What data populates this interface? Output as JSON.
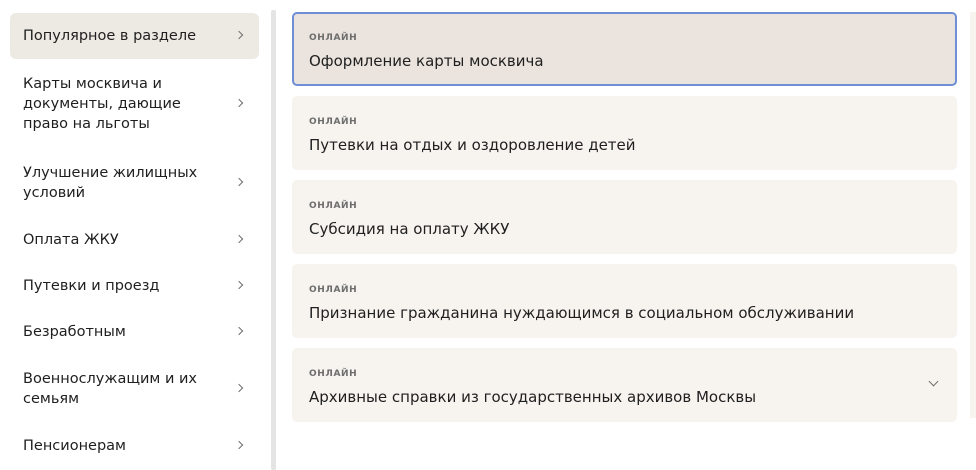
{
  "sidebar": {
    "items": [
      {
        "label": "Популярное в разделе"
      },
      {
        "label": "Карты москвича и документы, дающие право на льготы"
      },
      {
        "label": "Улучшение жилищных условий"
      },
      {
        "label": "Оплата ЖКУ"
      },
      {
        "label": "Путевки и проезд"
      },
      {
        "label": "Безработным"
      },
      {
        "label": "Военнослужащим и их семьям"
      },
      {
        "label": "Пенсионерам"
      }
    ]
  },
  "services": [
    {
      "tag": "ОНЛАЙН",
      "title": "Оформление карты москвича"
    },
    {
      "tag": "ОНЛАЙН",
      "title": "Путевки на отдых и оздоровление детей"
    },
    {
      "tag": "ОНЛАЙН",
      "title": "Субсидия на оплату ЖКУ"
    },
    {
      "tag": "ОНЛАЙН",
      "title": "Признание гражданина нуждающимся в социальном обслуживании"
    },
    {
      "tag": "ОНЛАЙН",
      "title": "Архивные справки из государственных архивов Москвы"
    }
  ]
}
